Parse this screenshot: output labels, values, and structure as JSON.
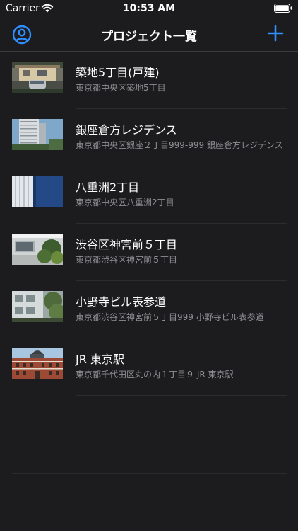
{
  "status_bar": {
    "carrier": "Carrier",
    "time": "10:53 AM",
    "icons": [
      "wifi-icon",
      "battery-icon"
    ]
  },
  "nav": {
    "title": "プロジェクト一覧",
    "left_icon": "person-circle-icon",
    "right_icon": "plus-icon",
    "accent_color": "#2f8fff"
  },
  "projects": [
    {
      "title": "築地5丁目(戸建)",
      "subtitle": "東京都中央区築地5丁目",
      "thumbnail": "house-photo"
    },
    {
      "title": "銀座倉方レジデンス",
      "subtitle": "東京都中央区銀座２丁目999-999 銀座倉方レジデンス",
      "thumbnail": "tower-photo"
    },
    {
      "title": "八重洲2丁目",
      "subtitle": "東京都中央区八重洲2丁目",
      "thumbnail": "office-building-photo"
    },
    {
      "title": "渋谷区神宮前５丁目",
      "subtitle": "東京都渋谷区神宮前５丁目",
      "thumbnail": "white-building-photo"
    },
    {
      "title": "小野寺ビル表参道",
      "subtitle": "東京都渋谷区神宮前５丁目999 小野寺ビル表参道",
      "thumbnail": "building-with-trees-photo"
    },
    {
      "title": "JR 東京駅",
      "subtitle": "東京都千代田区丸の内１丁目９ JR 東京駅",
      "thumbnail": "tokyo-station-photo"
    }
  ]
}
